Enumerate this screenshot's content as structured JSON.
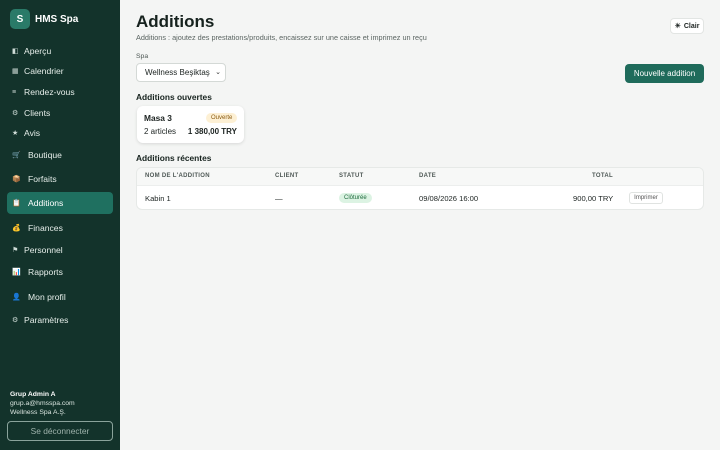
{
  "app": {
    "logo_letter": "S",
    "name": "HMS Spa"
  },
  "sidebar": {
    "items": [
      {
        "icon": "◧",
        "label": "Aperçu"
      },
      {
        "icon": "▦",
        "label": "Calendrier"
      },
      {
        "icon": "≡",
        "label": "Rendez-vous"
      },
      {
        "icon": "⚙",
        "label": "Clients"
      },
      {
        "icon": "★",
        "label": "Avis"
      },
      {
        "icon": "🛒",
        "label": "Boutique"
      },
      {
        "icon": "📦",
        "label": "Forfaits"
      },
      {
        "icon": "📋",
        "label": "Additions"
      },
      {
        "icon": "💰",
        "label": "Finances"
      },
      {
        "icon": "⚑",
        "label": "Personnel"
      },
      {
        "icon": "📊",
        "label": "Rapports"
      },
      {
        "icon": "👤",
        "label": "Mon profil"
      },
      {
        "icon": "⚙",
        "label": "Paramètres"
      }
    ],
    "active_index": 7
  },
  "user": {
    "name": "Grup Admin A",
    "email": "grup.a@hmsspa.com",
    "org": "Wellness Spa A.Ş."
  },
  "logout_label": "Se déconnecter",
  "theme_toggle": {
    "icon": "☀",
    "label": "Clair"
  },
  "header": {
    "title": "Additions",
    "subtitle": "Additions : ajoutez des prestations/produits, encaissez sur une caisse et imprimez un reçu"
  },
  "spa_filter": {
    "label": "Spa",
    "value": "Wellness Beşiktaş"
  },
  "new_button_label": "Nouvelle addition",
  "open_section": {
    "title": "Additions ouvertes",
    "cards": [
      {
        "name": "Masa 3",
        "status": "Ouverte",
        "items": "2 articles",
        "total": "1 380,00 TRY"
      }
    ]
  },
  "recent_section": {
    "title": "Additions récentes",
    "columns": {
      "name": "NOM DE L'ADDITION",
      "client": "CLIENT",
      "status": "STATUT",
      "date": "DATE",
      "total": "TOTAL"
    },
    "rows": [
      {
        "name": "Kabin 1",
        "client": "—",
        "status": "Clôturée",
        "date": "09/08/2026 16:00",
        "total": "900,00 TRY",
        "action": "Imprimer"
      }
    ]
  },
  "colors": {
    "sidebar_bg": "#13332b",
    "accent": "#1f6b5b",
    "active_nav": "#1f7060"
  }
}
